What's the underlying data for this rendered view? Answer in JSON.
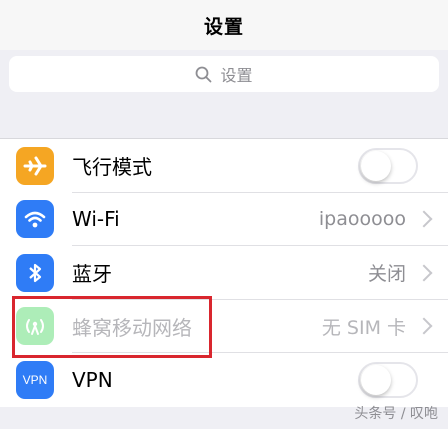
{
  "header": {
    "title": "设置"
  },
  "search": {
    "placeholder": "设置"
  },
  "rows": [
    {
      "label": "飞行模式",
      "control": "toggle",
      "state": "off",
      "icon": "airplane-icon",
      "color": "#f5a623"
    },
    {
      "label": "Wi-Fi",
      "value": "ipaooooo",
      "icon": "wifi-icon",
      "color": "#2f7cf6"
    },
    {
      "label": "蓝牙",
      "value": "关闭",
      "icon": "bluetooth-icon",
      "color": "#2f7cf6"
    },
    {
      "label": "蜂窝移动网络",
      "value": "无 SIM 卡",
      "icon": "cellular-icon",
      "color": "#4cd964",
      "dimmed": true
    },
    {
      "label": "VPN",
      "control": "toggle",
      "state": "off",
      "icon": "vpn-icon",
      "color": "#2f7cf6",
      "icon_text": "VPN"
    }
  ],
  "annotation": {
    "color": "#d9262e"
  },
  "watermark": {
    "text": "头条号 / 叹咆"
  }
}
